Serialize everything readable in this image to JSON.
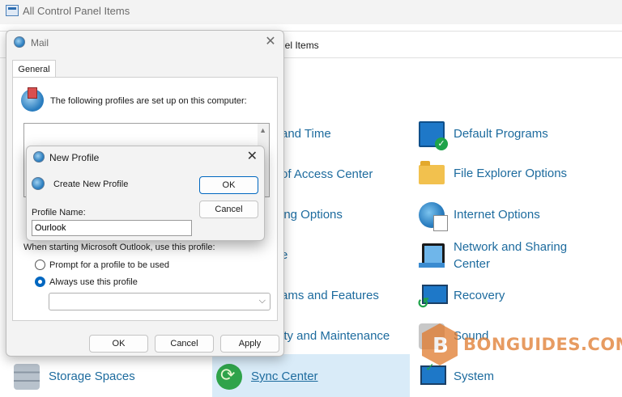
{
  "window": {
    "title": "All Control Panel Items"
  },
  "address": {
    "text": "nel Items"
  },
  "items_left_clipped": [
    {
      "label": "and Time"
    },
    {
      "label": "of Access Center"
    },
    {
      "label": "ing Options"
    },
    {
      "label": "e"
    },
    {
      "label": "ams and Features"
    },
    {
      "label": "ity and Maintenance"
    }
  ],
  "items_right": [
    {
      "label": "Default Programs",
      "icon": "default-programs-icon"
    },
    {
      "label": "File Explorer Options",
      "icon": "folder-icon"
    },
    {
      "label": "Internet Options",
      "icon": "internet-options-icon"
    },
    {
      "label": "Network and Sharing Center",
      "icon": "network-icon"
    },
    {
      "label": "Recovery",
      "icon": "recovery-icon"
    },
    {
      "label": "Sound",
      "icon": "sound-icon"
    },
    {
      "label": "System",
      "icon": "system-icon"
    }
  ],
  "bottom_items": {
    "storage": "Storage Spaces",
    "sync": "Sync Center"
  },
  "watermark": {
    "text": "BONGUIDES.COM"
  },
  "mail": {
    "title": "Mail",
    "tab": "General",
    "profiles_text": "The following profiles are set up on this computer:",
    "starting_label": "When starting Microsoft Outlook, use this profile:",
    "radio_prompt": "Prompt for a profile to be used",
    "radio_always": "Always use this profile",
    "ok": "OK",
    "cancel": "Cancel",
    "apply": "Apply"
  },
  "new_profile": {
    "title": "New Profile",
    "create_text": "Create New Profile",
    "name_label": "Profile Name:",
    "name_value": "Ourlook",
    "ok": "OK",
    "cancel": "Cancel"
  }
}
